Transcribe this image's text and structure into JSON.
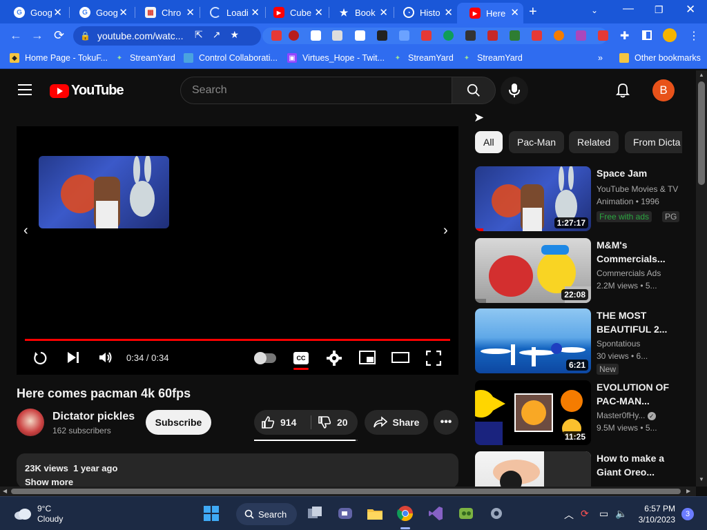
{
  "browser": {
    "tabs": [
      {
        "title": "Goog",
        "favicon": "google-icon"
      },
      {
        "title": "Goog",
        "favicon": "google-icon"
      },
      {
        "title": "Chro",
        "favicon": "chrome-store-icon"
      },
      {
        "title": "Loadi",
        "favicon": "loading-spinner-icon"
      },
      {
        "title": "Cube",
        "favicon": "youtube-icon"
      },
      {
        "title": "Book",
        "favicon": "star-icon"
      },
      {
        "title": "Histo",
        "favicon": "history-icon"
      },
      {
        "title": "Here",
        "favicon": "youtube-icon",
        "active": true
      }
    ],
    "url": "youtube.com/watc...",
    "bookmarks": [
      {
        "label": "Home Page - TokuF..."
      },
      {
        "label": "StreamYard"
      },
      {
        "label": "Control Collaborati..."
      },
      {
        "label": "Virtues_Hope - Twit..."
      },
      {
        "label": "StreamYard"
      },
      {
        "label": "StreamYard"
      }
    ],
    "overflow": "»",
    "other_bookmarks": "Other bookmarks"
  },
  "youtube": {
    "logo_text": "YouTube",
    "search_placeholder": "Search",
    "avatar_letter": "B",
    "player": {
      "time": "0:34 / 0:34",
      "progress": 1.0
    },
    "video": {
      "title": "Here comes pacman 4k 60fps",
      "channel": "Dictator pickles",
      "subscribers": "162 subscribers",
      "subscribe_label": "Subscribe",
      "likes": "914",
      "dislikes": "20",
      "like_ratio": 0.98,
      "share_label": "Share",
      "views": "23K views",
      "age": "1 year ago",
      "show_more": "Show more"
    },
    "chips": [
      "All",
      "Pac-Man",
      "Related",
      "From Dicta"
    ],
    "related": [
      {
        "title": "Space Jam",
        "line1": "YouTube Movies & TV",
        "line2": "Animation • 1996",
        "duration": "1:27:17",
        "badge_free": "Free with ads",
        "badge_rating": "PG"
      },
      {
        "title": "M&M's Commercials...",
        "line1": "Commercials Ads",
        "line2": "2.2M views  • 5...",
        "duration": "22:08"
      },
      {
        "title": "THE MOST BEAUTIFUL 2...",
        "line1": "Spontatious",
        "line2": "30 views  • 6...",
        "duration": "6:21",
        "badge_new": "New"
      },
      {
        "title": "EVOLUTION OF PAC-MAN...",
        "line1": "Master0fHy...",
        "line2": "9.5M views  • 5...",
        "duration": "11:25"
      },
      {
        "title": "How to make a Giant Oreo..."
      }
    ]
  },
  "taskbar": {
    "temp": "9°C",
    "weather": "Cloudy",
    "search_label": "Search",
    "time": "6:57 PM",
    "date": "3/10/2023",
    "notifications": "3"
  },
  "colors": {
    "chrome_blue": "#2f6cf0",
    "yt_bg": "#0f0f0f",
    "yt_red": "#ff0000"
  }
}
